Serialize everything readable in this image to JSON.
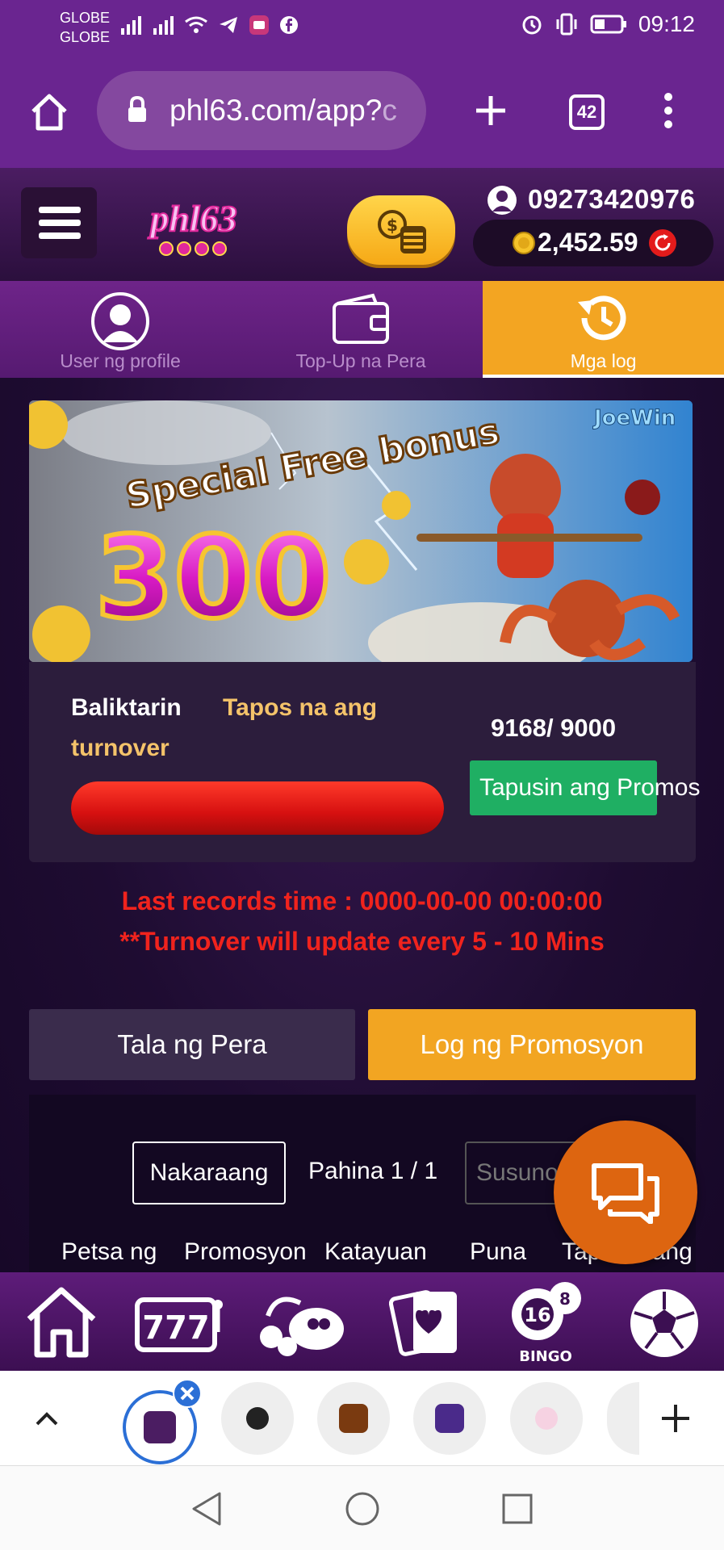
{
  "status_bar": {
    "carrier_1": "GLOBE",
    "carrier_2": "GLOBE",
    "time": "09:12"
  },
  "browser": {
    "url_main": "phl63.com/app?",
    "url_tail": "c",
    "tab_count": "42"
  },
  "header": {
    "logo_text": "phl63",
    "phone": "09273420976",
    "balance": "2,452.59"
  },
  "subnav": {
    "tabs": [
      {
        "label": "User ng profile",
        "icon": "user-icon"
      },
      {
        "label": "Top-Up na Pera",
        "icon": "wallet-icon"
      },
      {
        "label": "Mga log",
        "icon": "history-icon"
      }
    ]
  },
  "banner": {
    "line1": "Special Free bonus",
    "amount": "300",
    "brand": "JoeWin"
  },
  "turnover": {
    "label_1": "Baliktarin",
    "label_2": "Tapos na ang",
    "label_3": "turnover",
    "count": "9168/ 9000",
    "progress": 1.0,
    "finish_button": "Tapusin ang Promos"
  },
  "records": {
    "last_time": "Last records time : 0000-00-00 00:00:00",
    "note": "**Turnover will update every 5 - 10 Mins"
  },
  "tabs": {
    "money": "Tala ng Pera",
    "promo": "Log ng Promosyon"
  },
  "pagination": {
    "prev": "Nakaraang",
    "page": "Pahina 1 / 1",
    "next": "Susunod"
  },
  "table": {
    "headers": [
      "Petsa ng",
      "Promosyon",
      "Katayuan",
      "Puna",
      "Tapusin ang"
    ]
  },
  "game_bar": {
    "items": [
      "home-icon",
      "slots-777-icon",
      "fishing-icon",
      "cards-icon",
      "bingo-icon",
      "soccer-ball-icon"
    ],
    "bingo_label": "BINGO",
    "bingo_number": "16"
  },
  "colors": {
    "brand_purple": "#6a2590",
    "accent_orange": "#f2a522",
    "success_green": "#1faf63",
    "alert_red": "#f0231d"
  }
}
